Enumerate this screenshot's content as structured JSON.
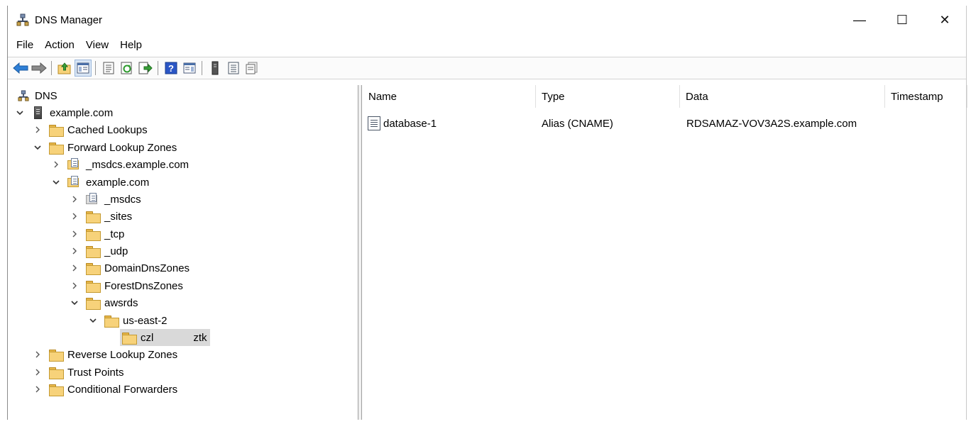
{
  "window": {
    "title": "DNS Manager",
    "controls": {
      "minimize": "—",
      "maximize": "☐",
      "close": "✕"
    }
  },
  "menu": [
    "File",
    "Action",
    "View",
    "Help"
  ],
  "toolbar": {
    "icons": [
      "back-icon",
      "forward-icon",
      "up-folder-icon",
      "show-hide-console-tree-icon",
      "properties-icon",
      "refresh-icon",
      "export-list-icon",
      "help-icon",
      "action-pane-icon",
      "server-icon",
      "list-icon",
      "details-icon"
    ]
  },
  "tree": {
    "root": "DNS",
    "server": "example.com",
    "cached_lookups": "Cached Lookups",
    "forward_lookup_zones": "Forward Lookup Zones",
    "msdcs_zone": "_msdcs.example.com",
    "example_zone": "example.com",
    "msdcs": "_msdcs",
    "sites": "_sites",
    "tcp": "_tcp",
    "udp": "_udp",
    "domain_dns_zones": "DomainDnsZones",
    "forest_dns_zones": "ForestDnsZones",
    "awsrds": "awsrds",
    "us_east_2": "us-east-2",
    "selected_left": "czl",
    "selected_right": "ztk",
    "reverse_lookup_zones": "Reverse Lookup Zones",
    "trust_points": "Trust Points",
    "conditional_forwarders": "Conditional Forwarders"
  },
  "list": {
    "columns": [
      "Name",
      "Type",
      "Data",
      "Timestamp"
    ],
    "rows": [
      {
        "name": "database-1",
        "type": "Alias (CNAME)",
        "data": "RDSAMAZ-VOV3A2S.example.com",
        "timestamp": ""
      }
    ]
  }
}
